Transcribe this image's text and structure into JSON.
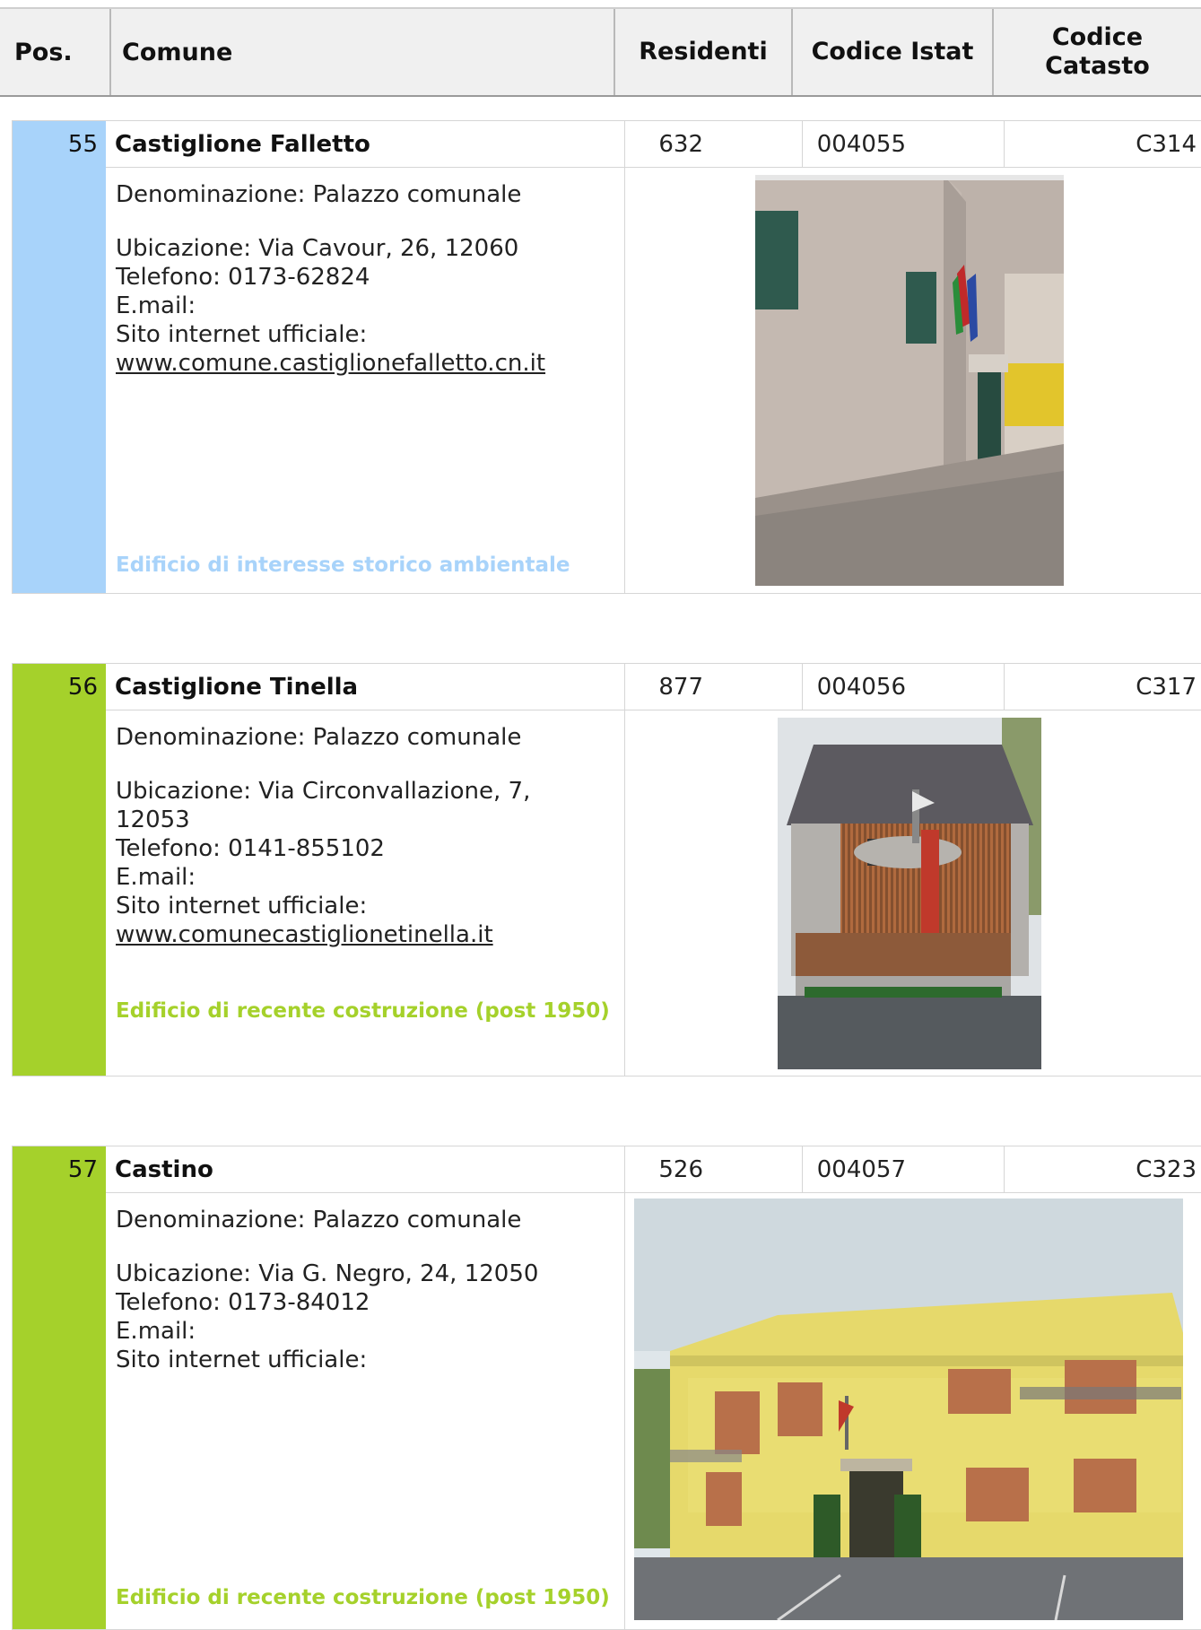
{
  "header": {
    "pos": "Pos.",
    "comune": "Comune",
    "residenti": "Residenti",
    "istat": "Codice Istat",
    "catasto_line1": "Codice",
    "catasto_line2": "Catasto"
  },
  "entries": [
    {
      "pos": "55",
      "comune": "Castiglione Falletto",
      "residenti": "632",
      "istat": "004055",
      "catasto": "C314",
      "denominazione": "Denominazione: Palazzo comunale",
      "ubicazione": "Ubicazione: Via Cavour, 26, 12060",
      "telefono": "Telefono: 0173-62824",
      "email": "E.mail:",
      "sito_label": "Sito internet ufficiale:",
      "sito": "www.comune.castiglionefalletto.cn.it",
      "tipologia": "Edificio di interesse storico ambientale",
      "color": "#a8d3fa"
    },
    {
      "pos": "56",
      "comune": "Castiglione Tinella",
      "residenti": "877",
      "istat": "004056",
      "catasto": "C317",
      "denominazione": "Denominazione: Palazzo comunale",
      "ubicazione": "Ubicazione: Via Circonvallazione, 7, 12053",
      "telefono": "Telefono: 0141-855102",
      "email": "E.mail:",
      "sito_label": "Sito internet ufficiale:",
      "sito": "www.comunecastiglionetinella.it",
      "tipologia": "Edificio di recente costruzione (post 1950)",
      "color": "#a5d12b"
    },
    {
      "pos": "57",
      "comune": "Castino",
      "residenti": "526",
      "istat": "004057",
      "catasto": "C323",
      "denominazione": "Denominazione: Palazzo comunale",
      "ubicazione": "Ubicazione: Via G. Negro, 24, 12050",
      "telefono": "Telefono: 0173-84012",
      "email": "E.mail:",
      "sito_label": "Sito internet ufficiale:",
      "sito": "",
      "tipologia": "Edificio di recente costruzione (post 1950)",
      "color": "#a5d12b"
    }
  ]
}
